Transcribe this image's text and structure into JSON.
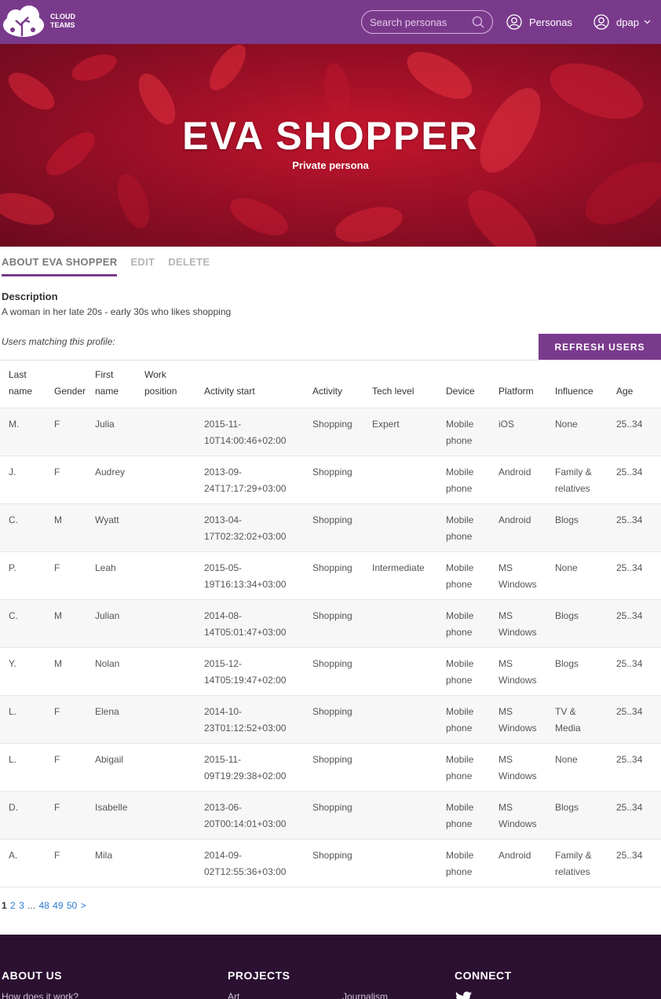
{
  "header": {
    "logo_line1": "CLOUD",
    "logo_line2": "TEAMS",
    "search_placeholder": "Search personas",
    "personas_link": "Personas",
    "user_name": "dpap"
  },
  "hero": {
    "title": "EVA SHOPPER",
    "subtitle": "Private persona"
  },
  "tabs": [
    {
      "label": "ABOUT EVA SHOPPER",
      "active": true
    },
    {
      "label": "EDIT",
      "active": false
    },
    {
      "label": "DELETE",
      "active": false
    }
  ],
  "description": {
    "heading": "Description",
    "text": "A woman in her late 20s - early 30s who likes shopping"
  },
  "users_label": "Users matching this profile:",
  "refresh_button": "REFRESH USERS",
  "table": {
    "headers": [
      {
        "line1": "Last",
        "line2": "name"
      },
      {
        "line1": "",
        "line2": "Gender"
      },
      {
        "line1": "First",
        "line2": "name"
      },
      {
        "line1": "Work",
        "line2": "position"
      },
      {
        "line1": "",
        "line2": "Activity start"
      },
      {
        "line1": "",
        "line2": "Activity"
      },
      {
        "line1": "",
        "line2": "Tech level"
      },
      {
        "line1": "",
        "line2": "Device"
      },
      {
        "line1": "",
        "line2": "Platform"
      },
      {
        "line1": "",
        "line2": "Influence"
      },
      {
        "line1": "",
        "line2": "Age"
      }
    ],
    "rows": [
      [
        "M.",
        "F",
        "Julia",
        "",
        [
          "2015-11-",
          "10T14:00:46+02:00"
        ],
        "Shopping",
        "Expert",
        [
          "Mobile",
          "phone"
        ],
        [
          "iOS",
          ""
        ],
        [
          "None",
          ""
        ],
        "25..34"
      ],
      [
        "J.",
        "F",
        "Audrey",
        "",
        [
          "2013-09-",
          "24T17:17:29+03:00"
        ],
        "Shopping",
        "",
        [
          "Mobile",
          "phone"
        ],
        [
          "Android",
          ""
        ],
        [
          "Family &",
          "relatives"
        ],
        "25..34"
      ],
      [
        "C.",
        "M",
        "Wyatt",
        "",
        [
          "2013-04-",
          "17T02:32:02+03:00"
        ],
        "Shopping",
        "",
        [
          "Mobile",
          "phone"
        ],
        [
          "Android",
          ""
        ],
        [
          "Blogs",
          ""
        ],
        "25..34"
      ],
      [
        "P.",
        "F",
        "Leah",
        "",
        [
          "2015-05-",
          "19T16:13:34+03:00"
        ],
        "Shopping",
        "Intermediate",
        [
          "Mobile",
          "phone"
        ],
        [
          "MS",
          "Windows"
        ],
        [
          "None",
          ""
        ],
        "25..34"
      ],
      [
        "C.",
        "M",
        "Julian",
        "",
        [
          "2014-08-",
          "14T05:01:47+03:00"
        ],
        "Shopping",
        "",
        [
          "Mobile",
          "phone"
        ],
        [
          "MS",
          "Windows"
        ],
        [
          "Blogs",
          ""
        ],
        "25..34"
      ],
      [
        "Y.",
        "M",
        "Nolan",
        "",
        [
          "2015-12-",
          "14T05:19:47+02:00"
        ],
        "Shopping",
        "",
        [
          "Mobile",
          "phone"
        ],
        [
          "MS",
          "Windows"
        ],
        [
          "Blogs",
          ""
        ],
        "25..34"
      ],
      [
        "L.",
        "F",
        "Elena",
        "",
        [
          "2014-10-",
          "23T01:12:52+03:00"
        ],
        "Shopping",
        "",
        [
          "Mobile",
          "phone"
        ],
        [
          "MS",
          "Windows"
        ],
        [
          "TV &",
          "Media"
        ],
        "25..34"
      ],
      [
        "L.",
        "F",
        "Abigail",
        "",
        [
          "2015-11-",
          "09T19:29:38+02:00"
        ],
        "Shopping",
        "",
        [
          "Mobile",
          "phone"
        ],
        [
          "MS",
          "Windows"
        ],
        [
          "None",
          ""
        ],
        "25..34"
      ],
      [
        "D.",
        "F",
        "Isabelle",
        "",
        [
          "2013-06-",
          "20T00:14:01+03:00"
        ],
        "Shopping",
        "",
        [
          "Mobile",
          "phone"
        ],
        [
          "MS",
          "Windows"
        ],
        [
          "Blogs",
          ""
        ],
        "25..34"
      ],
      [
        "A.",
        "F",
        "Mila",
        "",
        [
          "2014-09-",
          "02T12:55:36+03:00"
        ],
        "Shopping",
        "",
        [
          "Mobile",
          "phone"
        ],
        [
          "Android",
          ""
        ],
        [
          "Family &",
          "relatives"
        ],
        "25..34"
      ]
    ]
  },
  "pagination": {
    "current": "1",
    "pages": [
      "2",
      "3",
      "...",
      "48",
      "49",
      "50",
      ">"
    ]
  },
  "footer": {
    "about_heading": "ABOUT US",
    "about_link": "How does it work?",
    "projects_heading": "PROJECTS",
    "projects_link1": "Art",
    "projects_link2": "Journalism",
    "connect_heading": "CONNECT"
  },
  "colors": {
    "brand_purple": "#7a3a8c",
    "footer_bg": "#2b1032",
    "link_blue": "#2a7bd1"
  }
}
